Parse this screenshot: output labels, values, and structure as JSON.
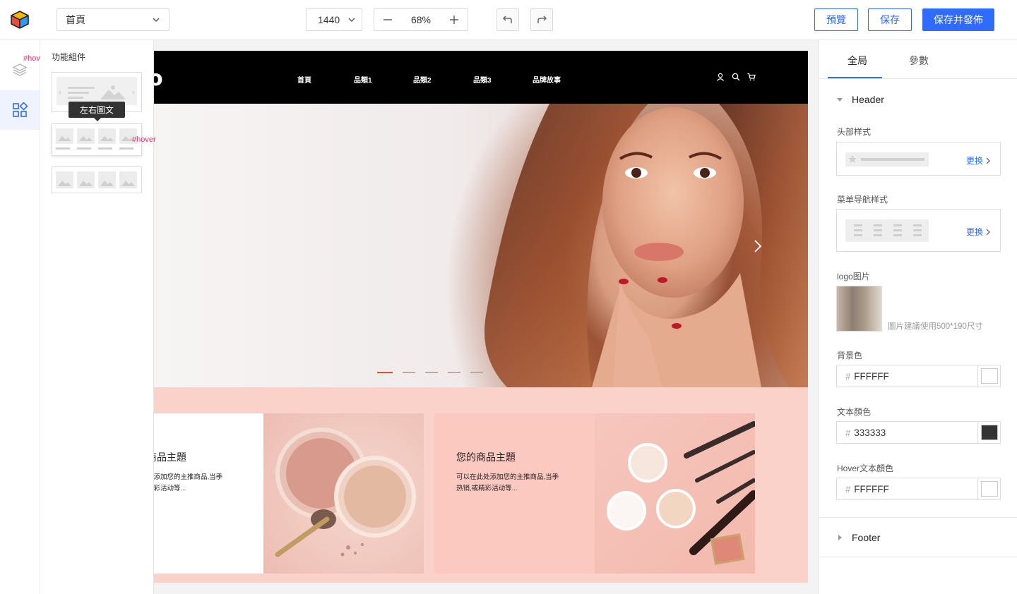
{
  "toolbar": {
    "page_select": "首頁",
    "width_select": "1440",
    "zoom": "68%",
    "preview_label": "預覽",
    "save_label": "保存",
    "publish_label": "保存并發佈",
    "accent_color": "#2f6bff"
  },
  "rail": {
    "hover_tag_top": "#hover",
    "icons": [
      "layers-icon",
      "components-icon"
    ]
  },
  "components": {
    "title": "功能組件",
    "tooltip": "左右圖文",
    "hover_tag": "#hover"
  },
  "site": {
    "logo": "o",
    "nav": [
      "首頁",
      "品類1",
      "品類2",
      "品類3",
      "品牌故事"
    ],
    "header_icons": [
      "user-icon",
      "search-icon",
      "cart-icon"
    ],
    "carousel_slides": 5,
    "carousel_active": 1,
    "promo": [
      {
        "title": "商品主題",
        "desc_line1": "处添加您的主推商品,当季",
        "desc_line2": "精彩活动等..."
      },
      {
        "title": "您的商品主題",
        "desc_line1": "可以在此处添加您的主推商品,当季",
        "desc_line2": "热销,或精彩活动等..."
      }
    ]
  },
  "props": {
    "tabs": [
      "全局",
      "參數"
    ],
    "header_section": "Header",
    "header_style_label": "头部样式",
    "menu_style_label": "菜单导航样式",
    "change_label": "更换",
    "logo_label": "logo图片",
    "logo_hint": "圖片建議使用500*190尺寸",
    "bg_label": "背景色",
    "bg_value": "FFFFFF",
    "bg_color": "#FFFFFF",
    "text_label": "文本顏色",
    "text_value": "333333",
    "text_color": "#333333",
    "hover_label": "Hover文本顏色",
    "hover_value": "FFFFFF",
    "hover_color": "#FFFFFF",
    "footer_section": "Footer"
  }
}
